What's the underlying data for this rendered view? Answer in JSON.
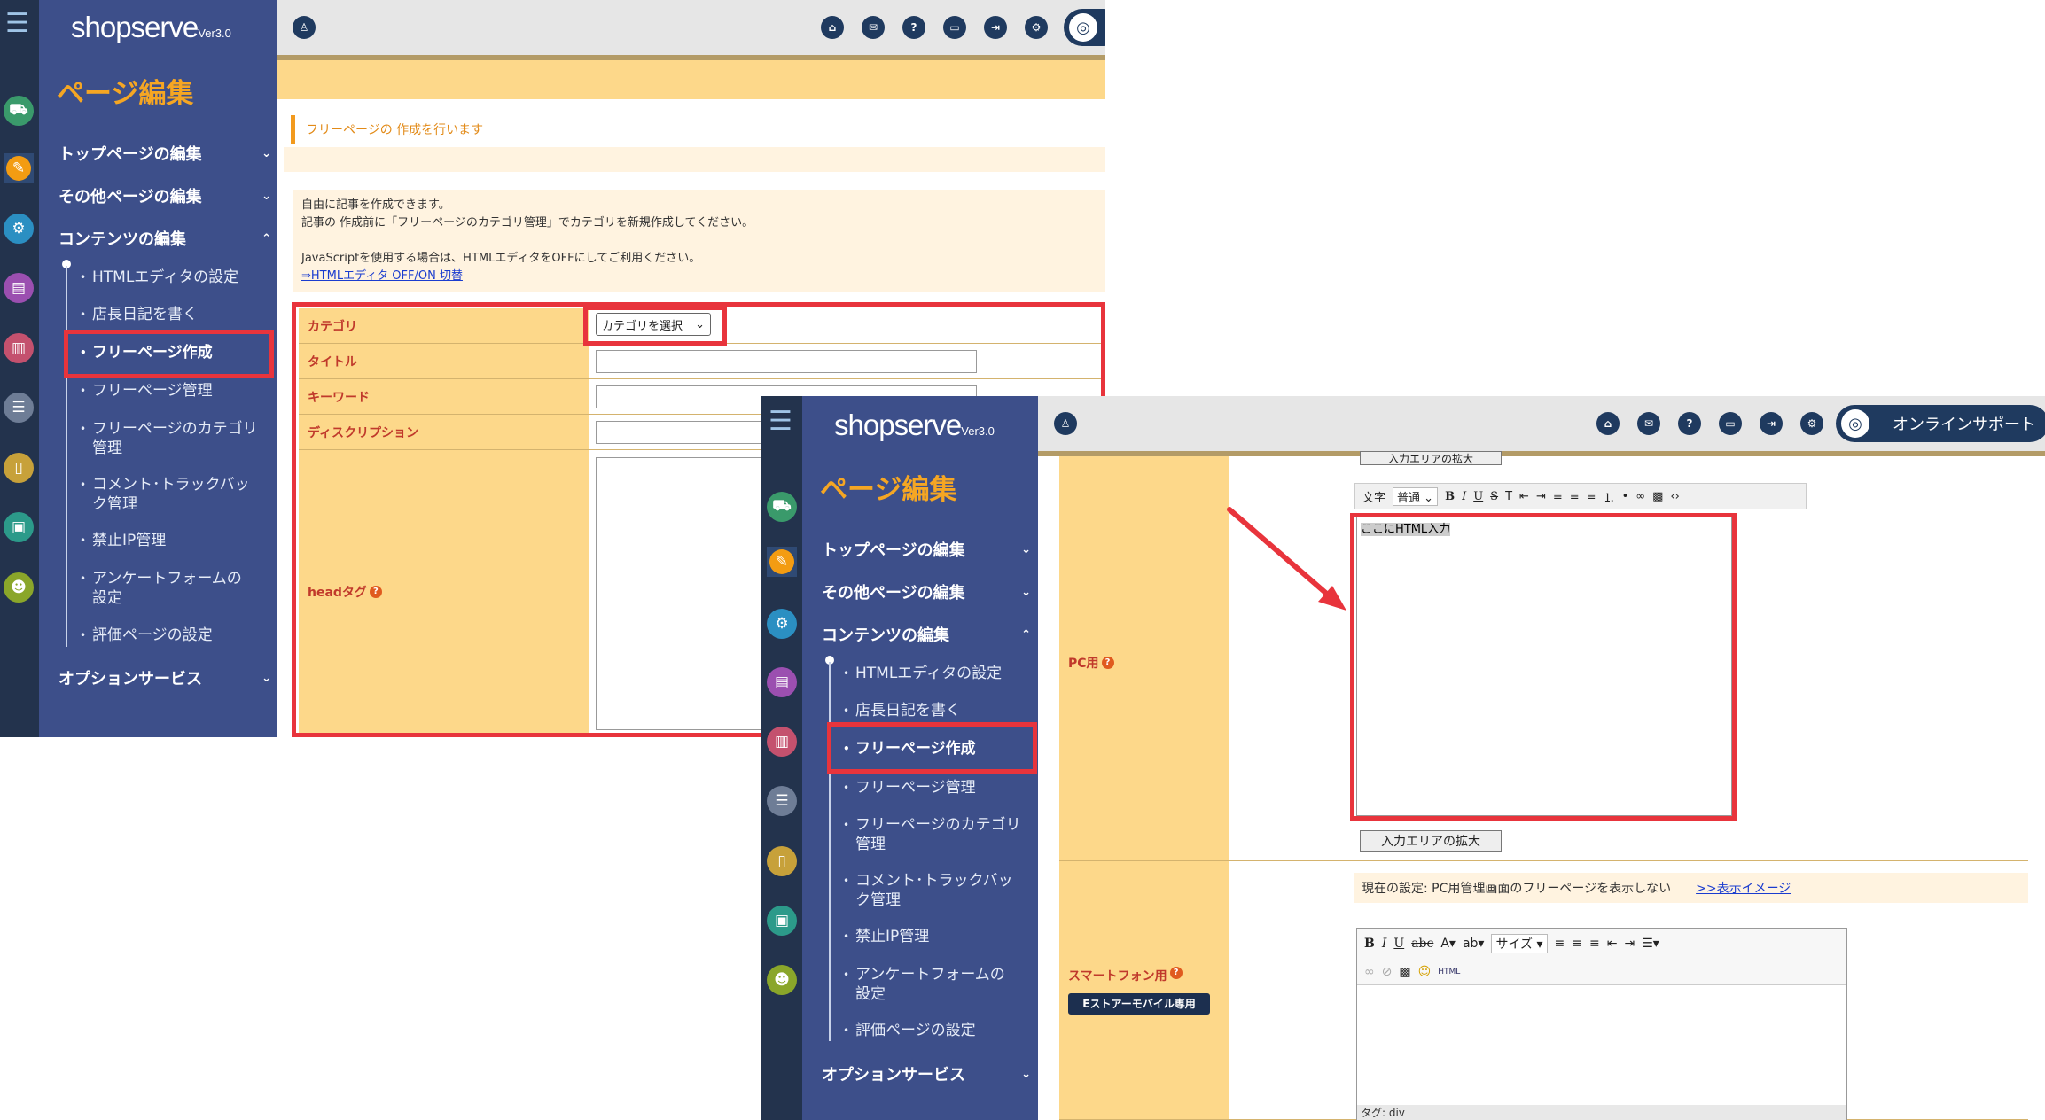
{
  "brand": {
    "name": "shopserve",
    "version": "Ver3.0"
  },
  "page_title": "ページ編集",
  "nav": {
    "top_page": "トップページの編集",
    "other_page": "その他ページの編集",
    "contents": "コンテンツの編集",
    "sub_items": [
      "HTMLエディタの設定",
      "店長日記を書く",
      "フリーページ作成",
      "フリーページ管理",
      "フリーページのカテゴリ管理",
      "コメント･トラックバック管理",
      "禁止IP管理",
      "アンケートフォームの設定",
      "評価ページの設定"
    ],
    "option": "オプションサービス"
  },
  "header": {
    "online_support": "オンラインサポート"
  },
  "notice": "フリーページの 作成を行います",
  "info": {
    "line1": "自由に記事を作成できます。",
    "line2": "記事の 作成前に「フリーページのカテゴリ管理」でカテゴリを新規作成してください。",
    "line3": "JavaScriptを使用する場合は、HTMLエディタをOFFにしてご利用ください。",
    "link": "⇒HTMLエディタ OFF/ON 切替"
  },
  "form": {
    "category": "カテゴリ",
    "category_select": "カテゴリを選択",
    "title": "タイトル",
    "keyword": "キーワード",
    "description": "ディスクリプション",
    "head_tag": "headタグ"
  },
  "editor": {
    "expand_button": "入力エリアの拡大",
    "pc_label": "PC用",
    "pc_content": "ここにHTML入力",
    "toolbar_text": "文字",
    "toolbar_style": "普通",
    "sp_label": "スマートフォン用",
    "sp_badge": "Eストアーモバイル専用",
    "current_setting": "現在の設定: PC用管理画面のフリーページを表示しない",
    "preview_link": ">>表示イメージ",
    "size": "サイズ",
    "tag_path": "タグ: div"
  }
}
